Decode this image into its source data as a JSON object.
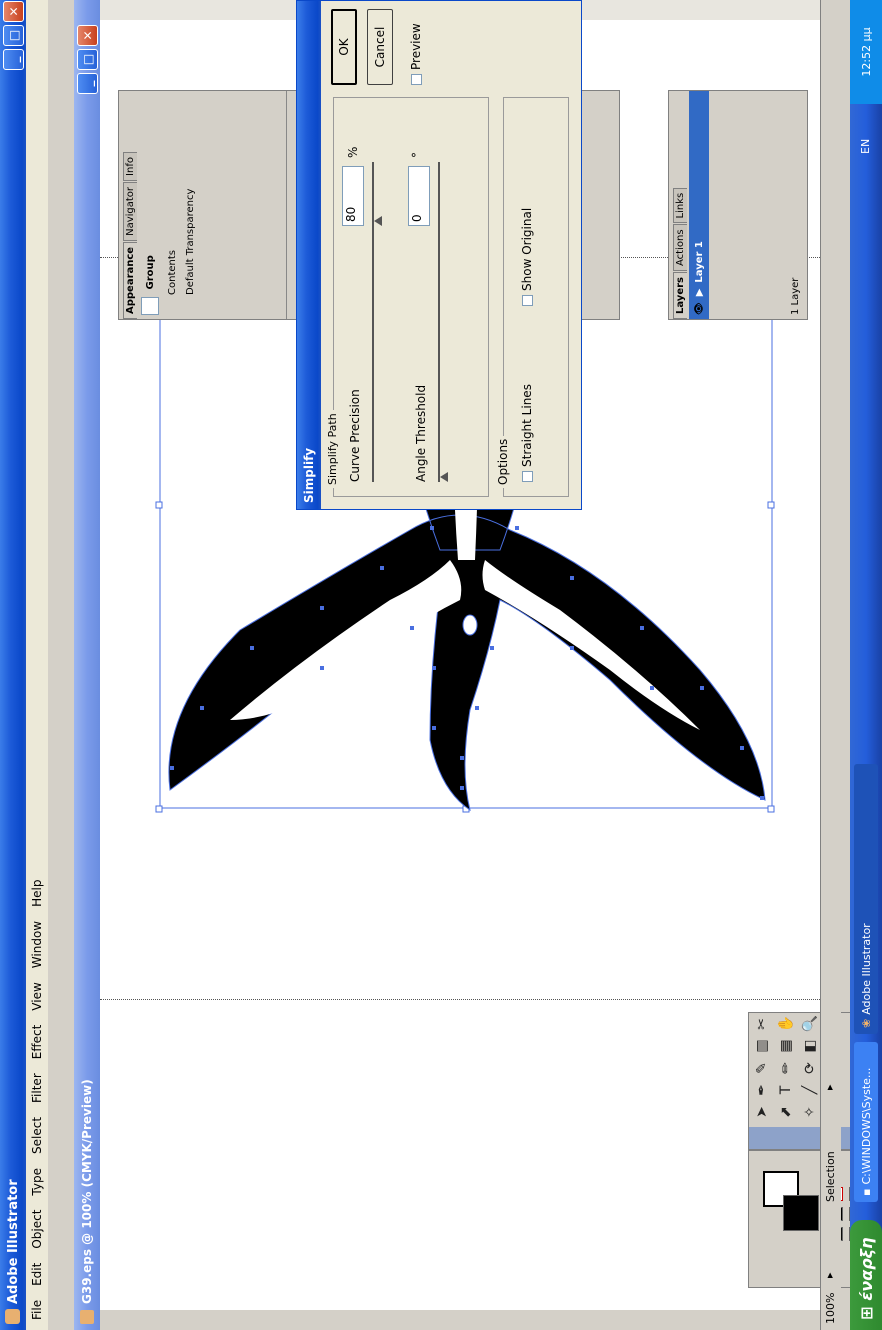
{
  "app": {
    "title": "Adobe Illustrator"
  },
  "menu": [
    "File",
    "Edit",
    "Object",
    "Type",
    "Select",
    "Filter",
    "Effect",
    "View",
    "Window",
    "Help"
  ],
  "document": {
    "title": "G39.eps @ 100% (CMYK/Preview)"
  },
  "status": {
    "zoom": "100%",
    "tool": "Selection"
  },
  "appearance": {
    "tabs": [
      "Appearance",
      "Navigator",
      "Info"
    ],
    "item": "Group",
    "contents": "Contents",
    "transparency": "Default Transparency"
  },
  "layers": {
    "tabs": [
      "Layers",
      "Actions",
      "Links"
    ],
    "layer_name": "Layer 1",
    "count": "1 Layer"
  },
  "dialog": {
    "title": "Simplify",
    "group_title": "Simplify Path",
    "curve_label": "Curve Precision",
    "curve_value": "80",
    "curve_unit": "%",
    "angle_label": "Angle Threshold",
    "angle_value": "0",
    "angle_unit": "°",
    "options_title": "Options",
    "straight_lines": "Straight Lines",
    "show_original": "Show Original",
    "ok": "OK",
    "cancel": "Cancel",
    "preview": "Preview",
    "curve_slider_pos": 0.8,
    "angle_slider_pos": 0.0
  },
  "taskbar": {
    "start": "έναρξη",
    "tasks": [
      "C:\\WINDOWS\\Syste...",
      "Adobe Illustrator"
    ],
    "lang": "EN",
    "clock": "12:52 μμ"
  },
  "colors": {
    "selection": "#4a6fe0",
    "accent": "#0a48c9"
  }
}
